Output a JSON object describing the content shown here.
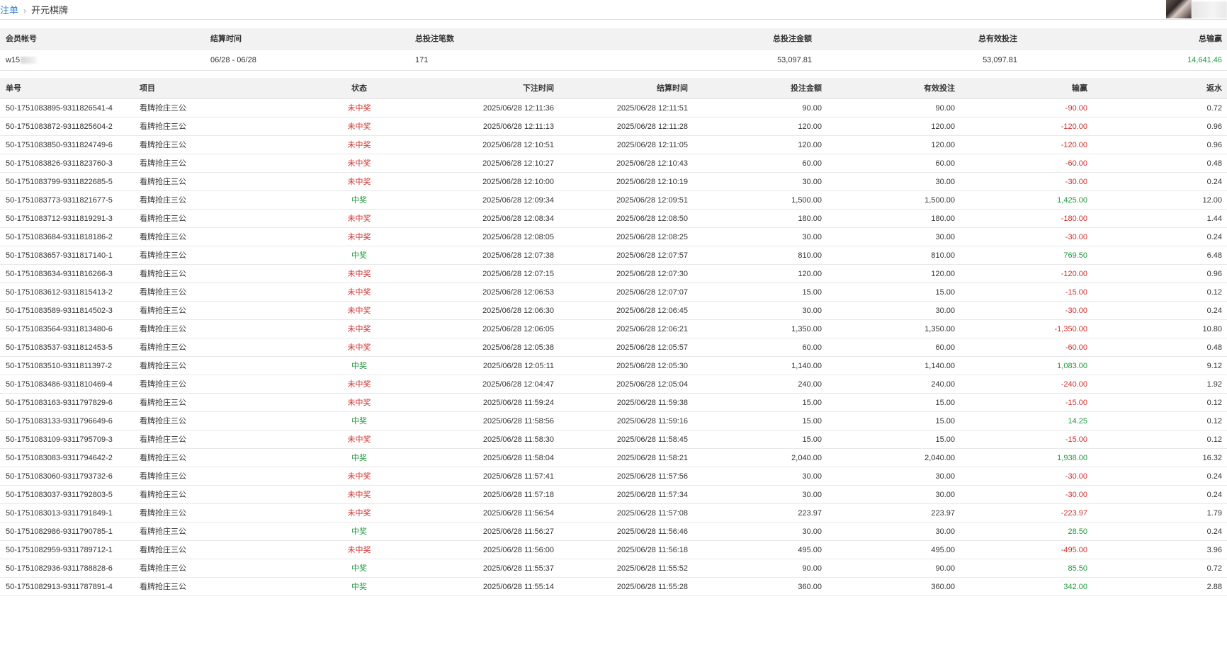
{
  "breadcrumb": {
    "parent": "注单",
    "current": "开元棋牌",
    "separator": "›"
  },
  "summary": {
    "headers": [
      "会员帐号",
      "结算时间",
      "总投注笔数",
      "总投注金额",
      "总有效投注",
      "总输赢"
    ],
    "values": {
      "account": "w15",
      "period": "06/28 - 06/28",
      "count": "171",
      "total_bet": "53,097.81",
      "total_valid": "53,097.81",
      "total_winloss": "14,641.46"
    }
  },
  "orders": {
    "headers": [
      "单号",
      "项目",
      "状态",
      "下注时间",
      "结算时间",
      "投注金额",
      "有效投注",
      "输赢",
      "返水"
    ],
    "rows": [
      [
        "50-1751083895-9311826541-4",
        "看牌抢庄三公",
        "未中奖",
        "2025/06/28 12:11:36",
        "2025/06/28 12:11:51",
        "90.00",
        "90.00",
        "-90.00",
        "0.72"
      ],
      [
        "50-1751083872-9311825604-2",
        "看牌抢庄三公",
        "未中奖",
        "2025/06/28 12:11:13",
        "2025/06/28 12:11:28",
        "120.00",
        "120.00",
        "-120.00",
        "0.96"
      ],
      [
        "50-1751083850-9311824749-6",
        "看牌抢庄三公",
        "未中奖",
        "2025/06/28 12:10:51",
        "2025/06/28 12:11:05",
        "120.00",
        "120.00",
        "-120.00",
        "0.96"
      ],
      [
        "50-1751083826-9311823760-3",
        "看牌抢庄三公",
        "未中奖",
        "2025/06/28 12:10:27",
        "2025/06/28 12:10:43",
        "60.00",
        "60.00",
        "-60.00",
        "0.48"
      ],
      [
        "50-1751083799-9311822685-5",
        "看牌抢庄三公",
        "未中奖",
        "2025/06/28 12:10:00",
        "2025/06/28 12:10:19",
        "30.00",
        "30.00",
        "-30.00",
        "0.24"
      ],
      [
        "50-1751083773-9311821677-5",
        "看牌抢庄三公",
        "中奖",
        "2025/06/28 12:09:34",
        "2025/06/28 12:09:51",
        "1,500.00",
        "1,500.00",
        "1,425.00",
        "12.00"
      ],
      [
        "50-1751083712-9311819291-3",
        "看牌抢庄三公",
        "未中奖",
        "2025/06/28 12:08:34",
        "2025/06/28 12:08:50",
        "180.00",
        "180.00",
        "-180.00",
        "1.44"
      ],
      [
        "50-1751083684-9311818186-2",
        "看牌抢庄三公",
        "未中奖",
        "2025/06/28 12:08:05",
        "2025/06/28 12:08:25",
        "30.00",
        "30.00",
        "-30.00",
        "0.24"
      ],
      [
        "50-1751083657-9311817140-1",
        "看牌抢庄三公",
        "中奖",
        "2025/06/28 12:07:38",
        "2025/06/28 12:07:57",
        "810.00",
        "810.00",
        "769.50",
        "6.48"
      ],
      [
        "50-1751083634-9311816266-3",
        "看牌抢庄三公",
        "未中奖",
        "2025/06/28 12:07:15",
        "2025/06/28 12:07:30",
        "120.00",
        "120.00",
        "-120.00",
        "0.96"
      ],
      [
        "50-1751083612-9311815413-2",
        "看牌抢庄三公",
        "未中奖",
        "2025/06/28 12:06:53",
        "2025/06/28 12:07:07",
        "15.00",
        "15.00",
        "-15.00",
        "0.12"
      ],
      [
        "50-1751083589-9311814502-3",
        "看牌抢庄三公",
        "未中奖",
        "2025/06/28 12:06:30",
        "2025/06/28 12:06:45",
        "30.00",
        "30.00",
        "-30.00",
        "0.24"
      ],
      [
        "50-1751083564-9311813480-6",
        "看牌抢庄三公",
        "未中奖",
        "2025/06/28 12:06:05",
        "2025/06/28 12:06:21",
        "1,350.00",
        "1,350.00",
        "-1,350.00",
        "10.80"
      ],
      [
        "50-1751083537-9311812453-5",
        "看牌抢庄三公",
        "未中奖",
        "2025/06/28 12:05:38",
        "2025/06/28 12:05:57",
        "60.00",
        "60.00",
        "-60.00",
        "0.48"
      ],
      [
        "50-1751083510-9311811397-2",
        "看牌抢庄三公",
        "中奖",
        "2025/06/28 12:05:11",
        "2025/06/28 12:05:30",
        "1,140.00",
        "1,140.00",
        "1,083.00",
        "9.12"
      ],
      [
        "50-1751083486-9311810469-4",
        "看牌抢庄三公",
        "未中奖",
        "2025/06/28 12:04:47",
        "2025/06/28 12:05:04",
        "240.00",
        "240.00",
        "-240.00",
        "1.92"
      ],
      [
        "50-1751083163-9311797829-6",
        "看牌抢庄三公",
        "未中奖",
        "2025/06/28 11:59:24",
        "2025/06/28 11:59:38",
        "15.00",
        "15.00",
        "-15.00",
        "0.12"
      ],
      [
        "50-1751083133-9311796649-6",
        "看牌抢庄三公",
        "中奖",
        "2025/06/28 11:58:56",
        "2025/06/28 11:59:16",
        "15.00",
        "15.00",
        "14.25",
        "0.12"
      ],
      [
        "50-1751083109-9311795709-3",
        "看牌抢庄三公",
        "未中奖",
        "2025/06/28 11:58:30",
        "2025/06/28 11:58:45",
        "15.00",
        "15.00",
        "-15.00",
        "0.12"
      ],
      [
        "50-1751083083-9311794642-2",
        "看牌抢庄三公",
        "中奖",
        "2025/06/28 11:58:04",
        "2025/06/28 11:58:21",
        "2,040.00",
        "2,040.00",
        "1,938.00",
        "16.32"
      ],
      [
        "50-1751083060-9311793732-6",
        "看牌抢庄三公",
        "未中奖",
        "2025/06/28 11:57:41",
        "2025/06/28 11:57:56",
        "30.00",
        "30.00",
        "-30.00",
        "0.24"
      ],
      [
        "50-1751083037-9311792803-5",
        "看牌抢庄三公",
        "未中奖",
        "2025/06/28 11:57:18",
        "2025/06/28 11:57:34",
        "30.00",
        "30.00",
        "-30.00",
        "0.24"
      ],
      [
        "50-1751083013-9311791849-1",
        "看牌抢庄三公",
        "未中奖",
        "2025/06/28 11:56:54",
        "2025/06/28 11:57:08",
        "223.97",
        "223.97",
        "-223.97",
        "1.79"
      ],
      [
        "50-1751082986-9311790785-1",
        "看牌抢庄三公",
        "中奖",
        "2025/06/28 11:56:27",
        "2025/06/28 11:56:46",
        "30.00",
        "30.00",
        "28.50",
        "0.24"
      ],
      [
        "50-1751082959-9311789712-1",
        "看牌抢庄三公",
        "未中奖",
        "2025/06/28 11:56:00",
        "2025/06/28 11:56:18",
        "495.00",
        "495.00",
        "-495.00",
        "3.96"
      ],
      [
        "50-1751082936-9311788828-6",
        "看牌抢庄三公",
        "中奖",
        "2025/06/28 11:55:37",
        "2025/06/28 11:55:52",
        "90.00",
        "90.00",
        "85.50",
        "0.72"
      ],
      [
        "50-1751082913-9311787891-4",
        "看牌抢庄三公",
        "中奖",
        "2025/06/28 11:55:14",
        "2025/06/28 11:55:28",
        "360.00",
        "360.00",
        "342.00",
        "2.88"
      ]
    ]
  },
  "colors": {
    "link": "#2f7fd6",
    "lose": "#d0312d",
    "win": "#1f9a3c",
    "header_bg": "#f2f2f2"
  }
}
